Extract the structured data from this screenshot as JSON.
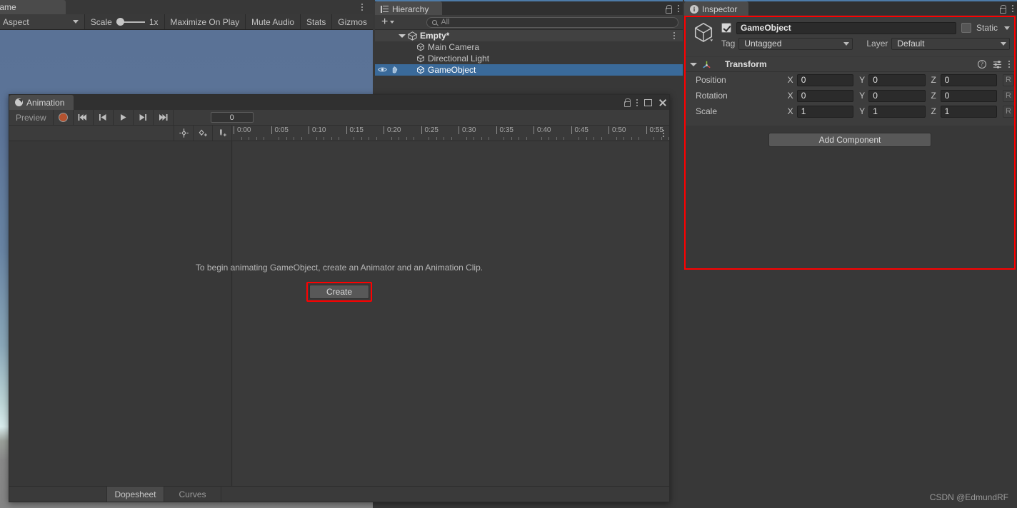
{
  "game_view": {
    "tab_label": "Game",
    "toolbar": {
      "aspect_label": "Aspect",
      "scale_label": "Scale",
      "scale_value": "1x",
      "maximize_on_play": "Maximize On Play",
      "mute_audio": "Mute Audio",
      "stats": "Stats",
      "gizmos": "Gizmos"
    },
    "icons": {
      "kebab": "kebab-menu-icon",
      "dropdown": "chevron-down-icon"
    }
  },
  "animation_window": {
    "tab_label": "Animation",
    "tab_icon": "clock-icon",
    "window_controls": [
      "lock-icon",
      "kebab-menu-icon",
      "maximize-icon",
      "close-icon"
    ],
    "toolbar": {
      "preview_label": "Preview",
      "record_button": "record-icon",
      "first_frame": "skip-to-start-icon",
      "prev_frame": "step-back-icon",
      "play": "play-icon",
      "next_frame": "step-forward-icon",
      "last_frame": "skip-to-end-icon",
      "frame_value": "0"
    },
    "row2_icons": [
      "add-keyframe-icon",
      "add-property-keyframe-icon",
      "add-event-icon"
    ],
    "timeline": {
      "labels": [
        "0:00",
        "0:05",
        "0:10",
        "0:15",
        "0:20",
        "0:25",
        "0:30",
        "0:35",
        "0:40",
        "0:45",
        "0:50",
        "0:55"
      ],
      "kebab": "kebab-menu-icon"
    },
    "empty_message": "To begin animating GameObject, create an Animator and an Animation Clip.",
    "create_button": "Create",
    "create_button_highlight_color": "#ff0000",
    "bottom_tabs": [
      {
        "label": "Dopesheet",
        "active": true
      },
      {
        "label": "Curves",
        "active": false
      }
    ]
  },
  "hierarchy": {
    "tab_label": "Hierarchy",
    "tab_icon": "hierarchy-list-icon",
    "window_controls": [
      "lock-icon",
      "kebab-menu-icon"
    ],
    "add_button": "+",
    "search_placeholder": "All",
    "search_icon": "search-icon",
    "rows": [
      {
        "label": "Empty*",
        "type": "scene",
        "depth": 0,
        "selected": false,
        "expanded": true,
        "icon": "scene-icon"
      },
      {
        "label": "Main Camera",
        "type": "gameobject",
        "depth": 1,
        "selected": false,
        "icon": "cube-icon"
      },
      {
        "label": "Directional Light",
        "type": "gameobject",
        "depth": 1,
        "selected": false,
        "icon": "cube-icon"
      },
      {
        "label": "GameObject",
        "type": "gameobject",
        "depth": 1,
        "selected": true,
        "icon": "cube-icon"
      }
    ],
    "selected_row_icons": [
      "eye-icon",
      "hand-icon"
    ],
    "selection_color": "#3a6a9a"
  },
  "inspector": {
    "tab_label": "Inspector",
    "tab_icon": "info-icon",
    "window_controls": [
      "lock-icon",
      "kebab-menu-icon"
    ],
    "highlight_color": "#ff0000",
    "object_header": {
      "icon": "gameobject-cube-icon",
      "enabled": true,
      "name": "GameObject",
      "static_label": "Static",
      "static_checked": false,
      "tag_label": "Tag",
      "tag_value": "Untagged",
      "layer_label": "Layer",
      "layer_value": "Default"
    },
    "transform": {
      "title": "Transform",
      "icon": "transform-axis-icon",
      "header_icons": [
        "help-icon",
        "preset-icon",
        "kebab-menu-icon"
      ],
      "rows": [
        {
          "name": "Position",
          "x": "0",
          "y": "0",
          "z": "0",
          "reset": "R"
        },
        {
          "name": "Rotation",
          "x": "0",
          "y": "0",
          "z": "0",
          "reset": "R"
        },
        {
          "name": "Scale",
          "x": "1",
          "y": "1",
          "z": "1",
          "reset": "R"
        }
      ],
      "axis_labels": [
        "X",
        "Y",
        "Z"
      ]
    },
    "add_component_button": "Add Component"
  },
  "watermark": "CSDN @EdmundRF"
}
